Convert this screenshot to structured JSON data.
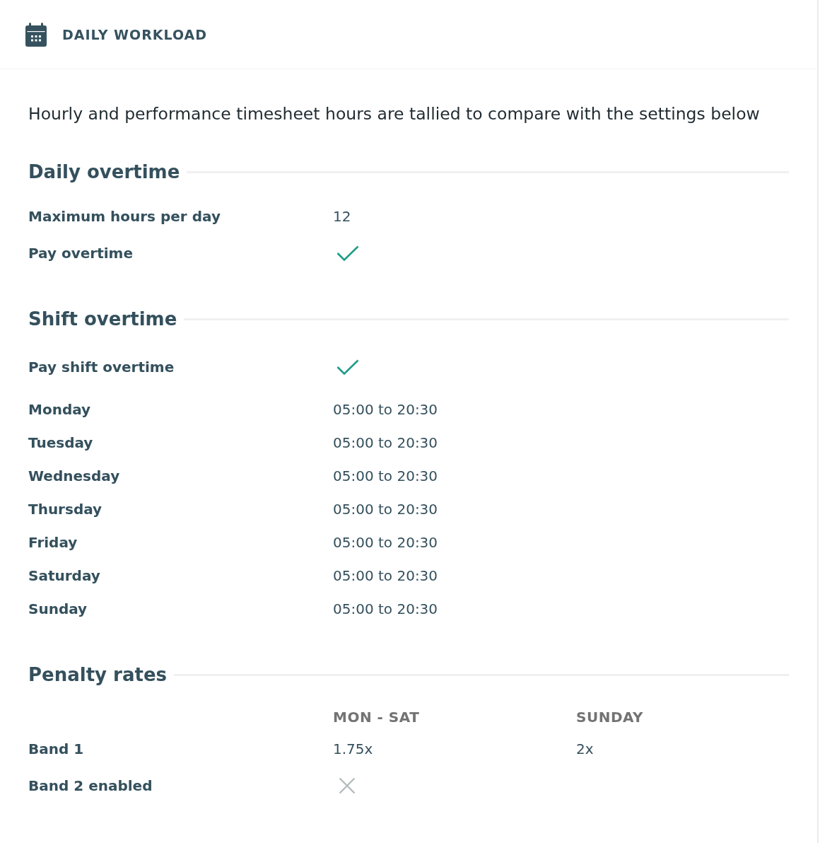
{
  "header": {
    "title": "DAILY WORKLOAD"
  },
  "intro": "Hourly and performance timesheet hours are tallied to compare with the settings below",
  "sections": [
    {
      "title": "Daily overtime",
      "rows": [
        {
          "kind": "text",
          "label": "Maximum hours per day",
          "values": [
            "12"
          ]
        },
        {
          "kind": "check",
          "label": "Pay overtime",
          "checked": true
        }
      ]
    },
    {
      "title": "Shift overtime",
      "rows": [
        {
          "kind": "check",
          "label": "Pay shift overtime",
          "checked": true
        },
        {
          "kind": "text",
          "label": "Monday",
          "values": [
            "05:00 to 20:30"
          ]
        },
        {
          "kind": "text",
          "label": "Tuesday",
          "values": [
            "05:00 to 20:30"
          ]
        },
        {
          "kind": "text",
          "label": "Wednesday",
          "values": [
            "05:00 to 20:30"
          ]
        },
        {
          "kind": "text",
          "label": "Thursday",
          "values": [
            "05:00 to 20:30"
          ]
        },
        {
          "kind": "text",
          "label": "Friday",
          "values": [
            "05:00 to 20:30"
          ]
        },
        {
          "kind": "text",
          "label": "Saturday",
          "values": [
            "05:00 to 20:30"
          ]
        },
        {
          "kind": "text",
          "label": "Sunday",
          "values": [
            "05:00 to 20:30"
          ]
        }
      ]
    },
    {
      "title": "Penalty rates",
      "columns": [
        "MON - SAT",
        "SUNDAY"
      ],
      "rows": [
        {
          "kind": "text",
          "label": "Band 1",
          "values": [
            "1.75x",
            "2x"
          ]
        },
        {
          "kind": "check",
          "label": "Band 2 enabled",
          "checked": false
        }
      ]
    }
  ]
}
